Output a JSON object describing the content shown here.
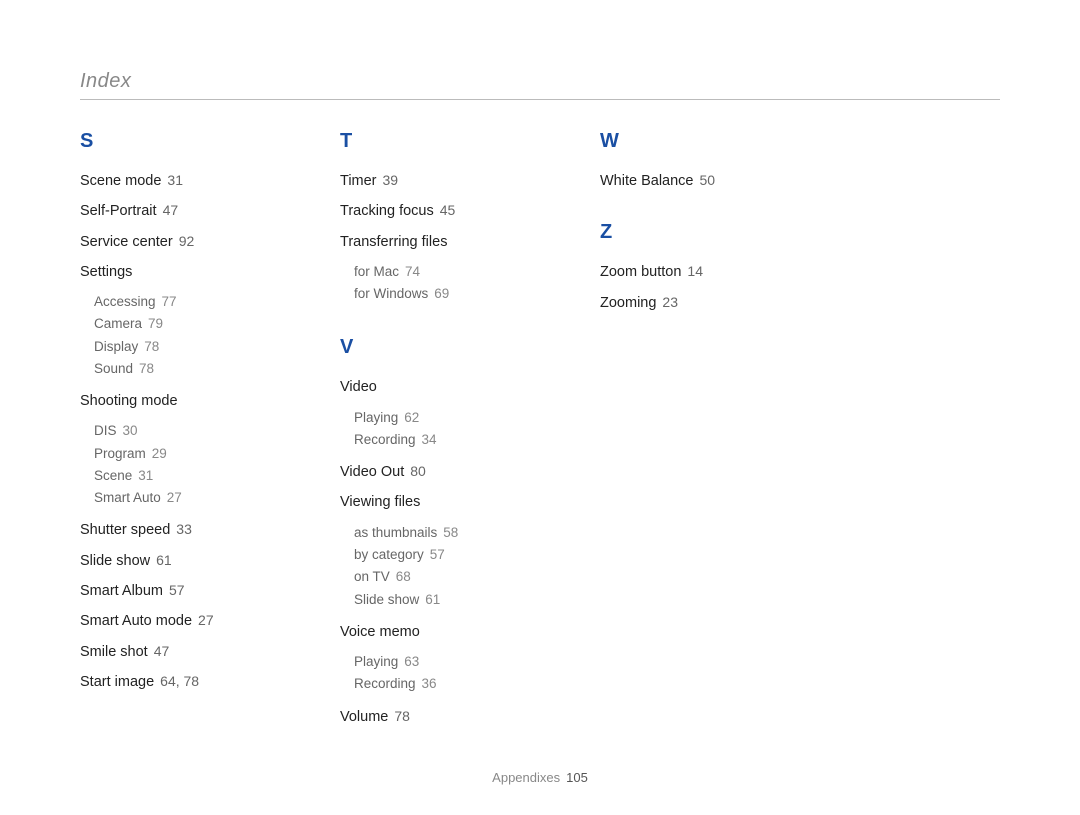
{
  "header": {
    "title": "Index"
  },
  "footer": {
    "label": "Appendixes",
    "page": "105"
  },
  "columns": {
    "S": {
      "letter": "S",
      "items": [
        {
          "label": "Scene mode",
          "page": "31"
        },
        {
          "label": "Self-Portrait",
          "page": "47"
        },
        {
          "label": "Service center",
          "page": "92"
        },
        {
          "label": "Settings",
          "subs": [
            {
              "label": "Accessing",
              "page": "77"
            },
            {
              "label": "Camera",
              "page": "79"
            },
            {
              "label": "Display",
              "page": "78"
            },
            {
              "label": "Sound",
              "page": "78"
            }
          ]
        },
        {
          "label": "Shooting mode",
          "subs": [
            {
              "label": "DIS",
              "page": "30"
            },
            {
              "label": "Program",
              "page": "29"
            },
            {
              "label": "Scene",
              "page": "31"
            },
            {
              "label": "Smart Auto",
              "page": "27"
            }
          ]
        },
        {
          "label": "Shutter speed",
          "page": "33"
        },
        {
          "label": "Slide show",
          "page": "61"
        },
        {
          "label": "Smart Album",
          "page": "57"
        },
        {
          "label": "Smart Auto mode",
          "page": "27"
        },
        {
          "label": "Smile shot",
          "page": "47"
        },
        {
          "label": "Start image",
          "page": "64, 78"
        }
      ]
    },
    "T": {
      "letter": "T",
      "items": [
        {
          "label": "Timer",
          "page": "39"
        },
        {
          "label": "Tracking focus",
          "page": "45"
        },
        {
          "label": "Transferring files",
          "subs": [
            {
              "label": "for Mac",
              "page": "74"
            },
            {
              "label": "for Windows",
              "page": "69"
            }
          ]
        }
      ]
    },
    "V": {
      "letter": "V",
      "items": [
        {
          "label": "Video",
          "subs": [
            {
              "label": "Playing",
              "page": "62"
            },
            {
              "label": "Recording",
              "page": "34"
            }
          ]
        },
        {
          "label": "Video Out",
          "page": "80"
        },
        {
          "label": "Viewing files",
          "subs": [
            {
              "label": "as thumbnails",
              "page": "58"
            },
            {
              "label": "by category",
              "page": "57"
            },
            {
              "label": "on TV",
              "page": "68"
            },
            {
              "label": "Slide show",
              "page": "61"
            }
          ]
        },
        {
          "label": "Voice memo",
          "subs": [
            {
              "label": "Playing",
              "page": "63"
            },
            {
              "label": "Recording",
              "page": "36"
            }
          ]
        },
        {
          "label": "Volume",
          "page": "78"
        }
      ]
    },
    "W": {
      "letter": "W",
      "items": [
        {
          "label": "White Balance",
          "page": "50"
        }
      ]
    },
    "Z": {
      "letter": "Z",
      "items": [
        {
          "label": "Zoom button",
          "page": "14"
        },
        {
          "label": "Zooming",
          "page": "23"
        }
      ]
    }
  }
}
